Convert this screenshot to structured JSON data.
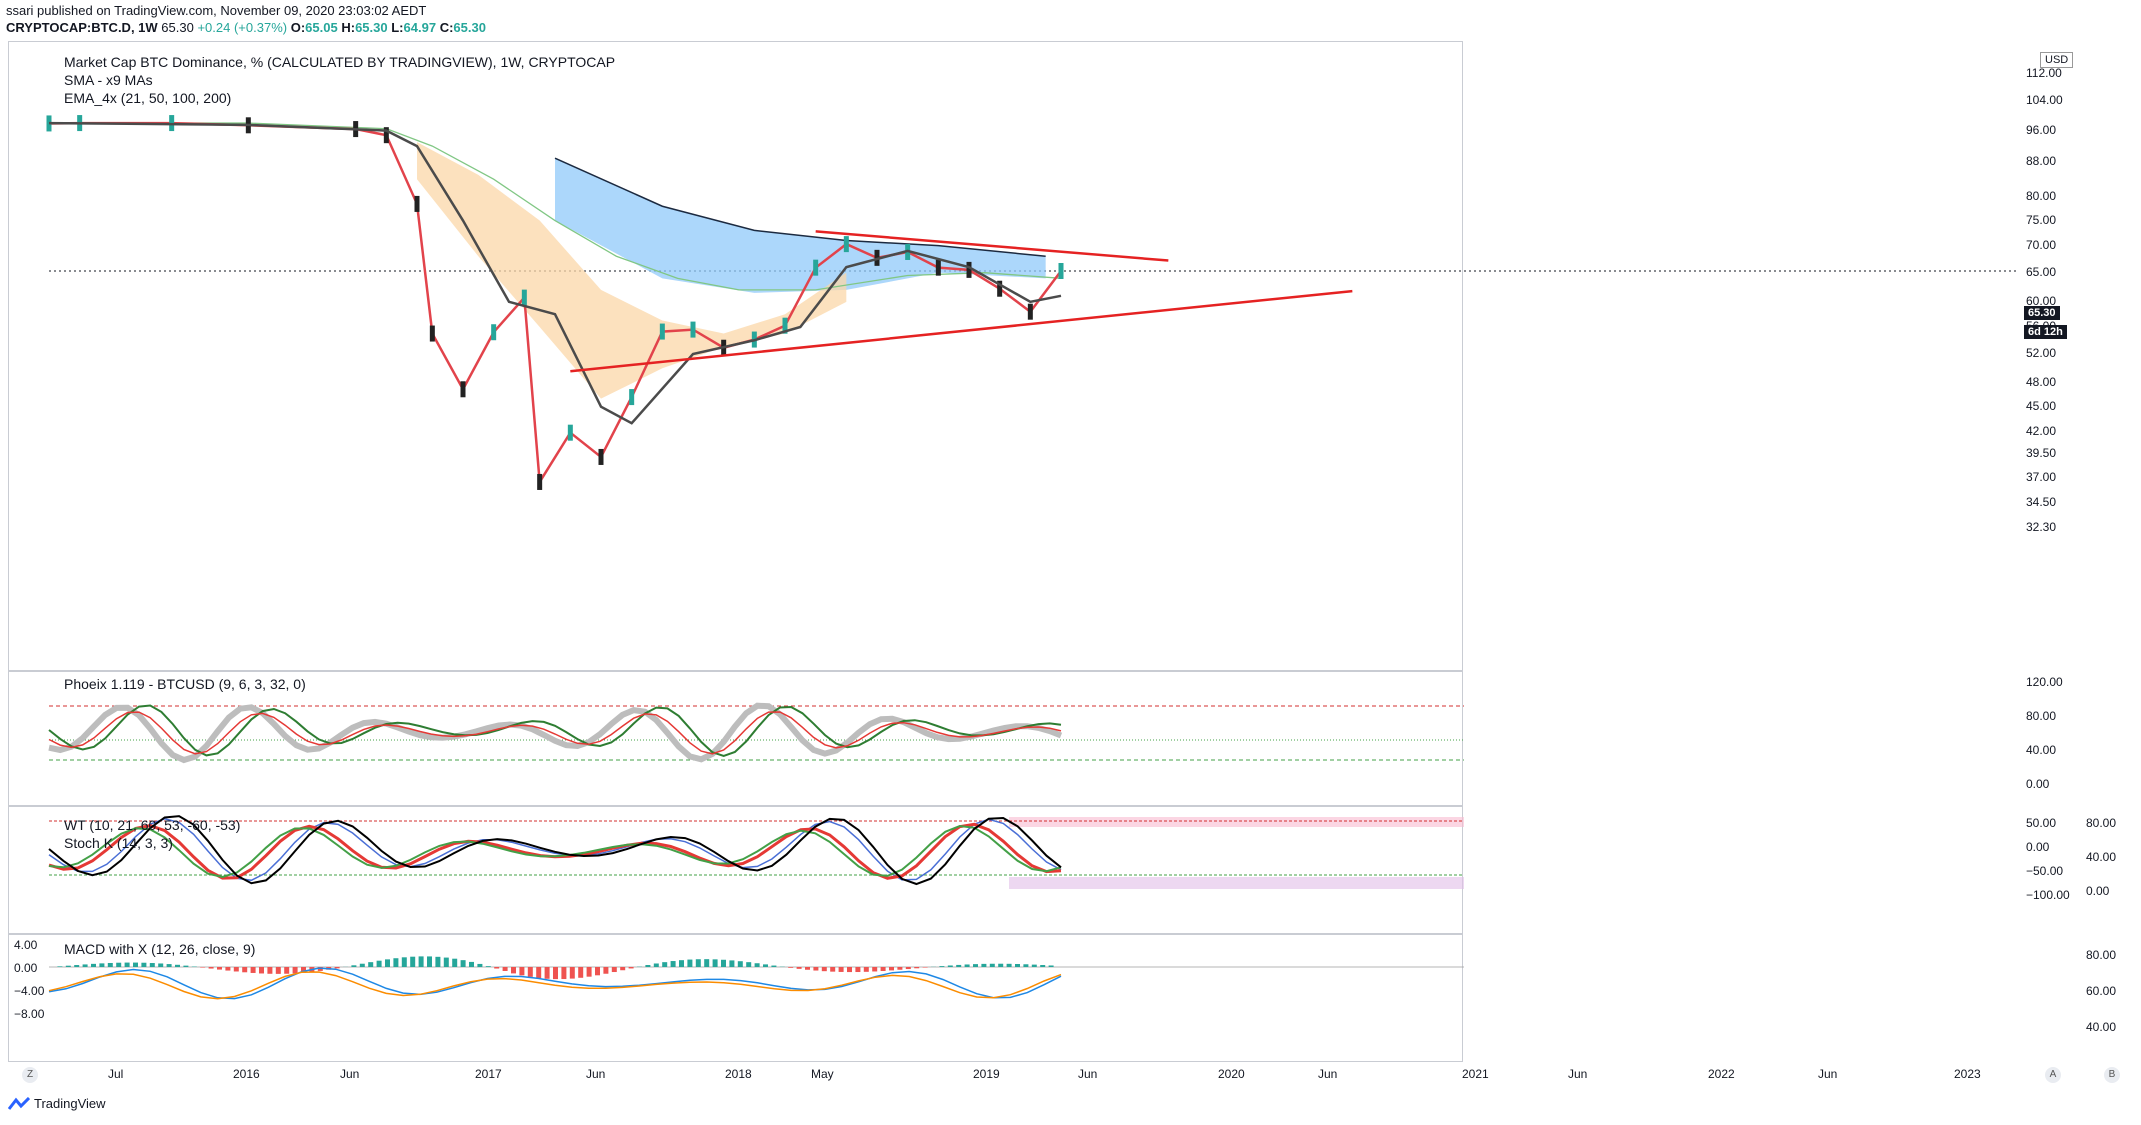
{
  "header": {
    "published": "ssari published on TradingView.com, November 09, 2020 23:03:02 AEDT",
    "symbol": "CRYPTOCAP:BTC.D, 1W",
    "price": "65.30",
    "change": "+0.24 (+0.37%)",
    "open_label": "O:",
    "open": "65.05",
    "high_label": "H:",
    "high": "65.30",
    "low_label": "L:",
    "low": "64.97",
    "close_label": "C:",
    "close": "65.30"
  },
  "main_pane": {
    "title": "Market Cap BTC Dominance, % (CALCULATED BY TRADINGVIEW), 1W, CRYPTOCAP",
    "ind1": "SMA - x9 MAs",
    "ind2": "EMA_4x (21, 50, 100, 200)",
    "currency": "USD",
    "last_price": "65.30",
    "countdown": "6d 12h",
    "y_ticks": [
      "112.00",
      "104.00",
      "96.00",
      "88.00",
      "80.00",
      "75.00",
      "70.00",
      "65.00",
      "60.00",
      "56.00",
      "52.00",
      "48.00",
      "45.00",
      "42.00",
      "39.50",
      "37.00",
      "34.50",
      "32.30"
    ]
  },
  "pane2": {
    "title": "Phoeix 1.119 - BTCUSD (9, 6, 3, 32, 0)",
    "y_ticks": [
      "120.00",
      "80.00",
      "40.00",
      "0.00"
    ]
  },
  "pane3": {
    "title1": "WT (10, 21, 60, 53, -60, -53)",
    "title2": "Stoch K (14, 3, 3)",
    "left_ticks": [
      "50.00",
      "0.00",
      "−50.00",
      "−100.00"
    ],
    "right_ticks": [
      "80.00",
      "40.00",
      "0.00"
    ]
  },
  "pane4": {
    "title": "MACD with X (12, 26, close, 9)",
    "left_ticks": [
      "4.00",
      "0.00",
      "−4.00",
      "−8.00"
    ],
    "right_ticks": [
      "80.00",
      "60.00",
      "40.00"
    ]
  },
  "time_axis": [
    "Jul",
    "2016",
    "Jun",
    "2017",
    "Jun",
    "2018",
    "May",
    "2019",
    "Jun",
    "2020",
    "Jun",
    "2021",
    "Jun",
    "2022",
    "Jun",
    "2023"
  ],
  "axis_buttons": {
    "left": "Z",
    "right_a": "A",
    "right_b": "B"
  },
  "footer": {
    "brand": "TradingView"
  },
  "colors": {
    "up": "#26a69a",
    "down": "#ef5350",
    "trendline": "#e52222",
    "cloud_blue": "#90caf9",
    "cloud_orange": "#fbd7a8"
  },
  "chart_data": {
    "type": "line",
    "title": "Market Cap BTC Dominance, % (CALCULATED BY TRADINGVIEW), 1W, CRYPTOCAP",
    "ylabel": "USD",
    "y_scale": "log",
    "ylim": [
      32.3,
      112
    ],
    "x": [
      "2015-05",
      "2015-07",
      "2016-01",
      "2016-06",
      "2017-01",
      "2017-03",
      "2017-05",
      "2017-06",
      "2017-08",
      "2017-10",
      "2017-12",
      "2018-01",
      "2018-03",
      "2018-05",
      "2018-07",
      "2018-09",
      "2018-11",
      "2019-01",
      "2019-03",
      "2019-05",
      "2019-07",
      "2019-09",
      "2019-11",
      "2020-01",
      "2020-03",
      "2020-05",
      "2020-07",
      "2020-09",
      "2020-11"
    ],
    "series": [
      {
        "values": [
          97.9,
          98.0,
          98.0,
          97.4,
          96.4,
          94.8,
          78.5,
          55.0,
          47.2,
          55.2,
          60.7,
          36.6,
          41.9,
          39.2,
          46.2,
          55.3,
          55.6,
          52.9,
          54.1,
          56.2,
          65.9,
          70.3,
          67.7,
          68.8,
          65.9,
          65.5,
          62.2,
          58.4,
          65.3
        ]
      }
    ],
    "trendlines": [
      {
        "from": [
          "2019-07",
          72.8
        ],
        "to": [
          "2021-06",
          67.2
        ]
      },
      {
        "from": [
          "2018-03",
          49.6
        ],
        "to": [
          "2022-06",
          61.8
        ]
      }
    ],
    "grid": false
  }
}
